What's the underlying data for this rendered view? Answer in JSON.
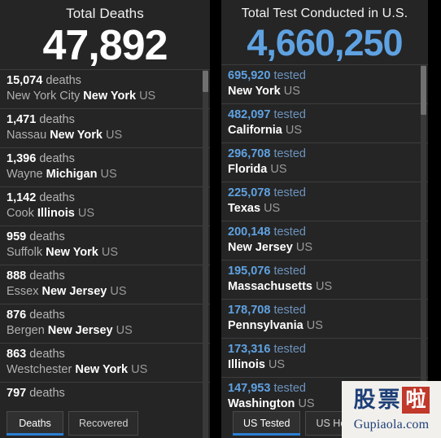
{
  "panels": {
    "deaths": {
      "title": "Total Deaths",
      "total": "47,892",
      "unit": "deaths",
      "country": "US",
      "rows": [
        {
          "value": "15,074",
          "place": "New York City",
          "region": "New York"
        },
        {
          "value": "1,471",
          "place": "Nassau",
          "region": "New York"
        },
        {
          "value": "1,396",
          "place": "Wayne",
          "region": "Michigan"
        },
        {
          "value": "1,142",
          "place": "Cook",
          "region": "Illinois"
        },
        {
          "value": "959",
          "place": "Suffolk",
          "region": "New York"
        },
        {
          "value": "888",
          "place": "Essex",
          "region": "New Jersey"
        },
        {
          "value": "876",
          "place": "Bergen",
          "region": "New Jersey"
        },
        {
          "value": "863",
          "place": "Westchester",
          "region": "New York"
        },
        {
          "value": "797",
          "place": "",
          "region": ""
        }
      ],
      "tabs": [
        {
          "label": "Deaths",
          "active": true
        },
        {
          "label": "Recovered",
          "active": false
        }
      ]
    },
    "tested": {
      "title": "Total Test Conducted in U.S.",
      "total": "4,660,250",
      "unit": "tested",
      "country": "US",
      "rows": [
        {
          "value": "695,920",
          "place": "",
          "region": "New York"
        },
        {
          "value": "482,097",
          "place": "",
          "region": "California"
        },
        {
          "value": "296,708",
          "place": "",
          "region": "Florida"
        },
        {
          "value": "225,078",
          "place": "",
          "region": "Texas"
        },
        {
          "value": "200,148",
          "place": "",
          "region": "New Jersey"
        },
        {
          "value": "195,076",
          "place": "",
          "region": "Massachusetts"
        },
        {
          "value": "178,708",
          "place": "",
          "region": "Pennsylvania"
        },
        {
          "value": "173,316",
          "place": "",
          "region": "Illinois"
        },
        {
          "value": "147,953",
          "place": "",
          "region": "Washington"
        }
      ],
      "tabs": [
        {
          "label": "US Tested",
          "active": true
        },
        {
          "label": "US Hospitalized",
          "active": false
        }
      ]
    }
  },
  "watermark": {
    "glyph1": "股",
    "glyph2": "票",
    "glyph3": "啦",
    "domain": "Gupiaola.com"
  },
  "colors": {
    "accent_blue": "#5fa2e2",
    "tab_underline": "#2a7fd4",
    "panel_bg": "#252525",
    "page_bg": "#000000",
    "watermark_red": "#c0392b",
    "watermark_navy": "#1d3f77"
  }
}
